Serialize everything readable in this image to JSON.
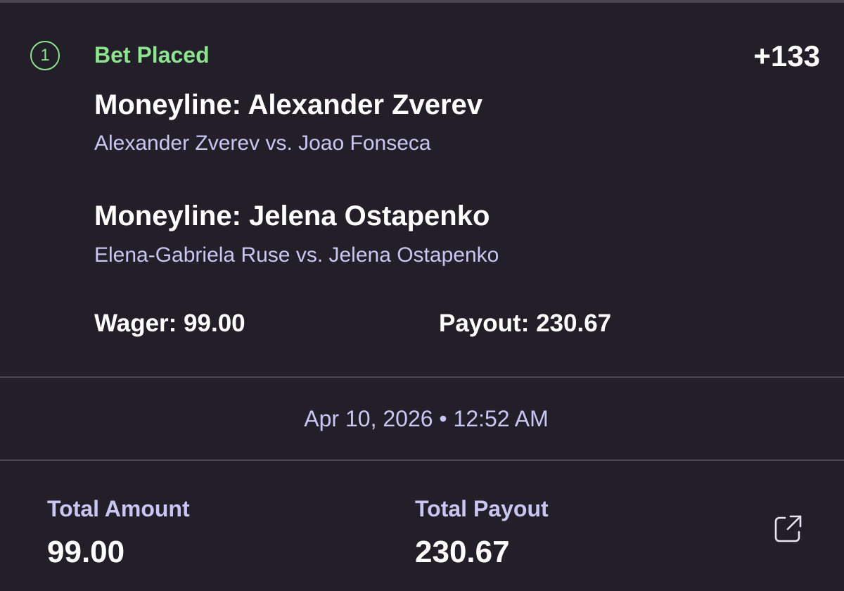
{
  "bet": {
    "leg_index": "1",
    "status": "Bet Placed",
    "odds": "+133",
    "legs": [
      {
        "title": "Moneyline: Alexander Zverev",
        "match": "Alexander Zverev vs. Joao Fonseca"
      },
      {
        "title": "Moneyline: Jelena Ostapenko",
        "match": "Elena-Gabriela Ruse vs. Jelena Ostapenko"
      }
    ],
    "wager": "Wager: 99.00",
    "payout": "Payout: 230.67",
    "timestamp": "Apr 10, 2026 • 12:52 AM"
  },
  "summary": {
    "total_amount_label": "Total Amount",
    "total_amount_value": "99.00",
    "total_payout_label": "Total Payout",
    "total_payout_value": "230.67"
  },
  "icons": {
    "share": "share-icon"
  },
  "colors": {
    "background": "#221f29",
    "accent_green": "#8ee38f",
    "secondary_text": "#c9c6f3",
    "divider": "#4b4856"
  }
}
